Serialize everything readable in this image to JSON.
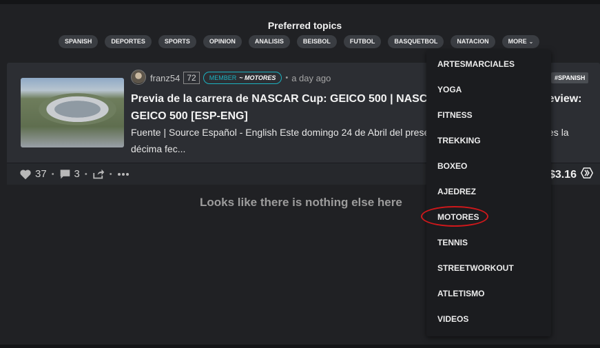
{
  "topics": {
    "title": "Preferred topics",
    "chips": [
      "SPANISH",
      "DEPORTES",
      "SPORTS",
      "OPINION",
      "ANALISIS",
      "BEISBOL",
      "FUTBOL",
      "BASQUETBOL",
      "NATACION"
    ],
    "more_label": "MORE"
  },
  "post": {
    "author": "franz54",
    "reputation": "72",
    "member_prefix": "MEMBER",
    "community": "~ MOTORES",
    "time": "a day ago",
    "tag": "#SPANISH",
    "title": "Previa de la carrera de NASCAR Cup: GEICO 500 | NASCAR Cup Series Race Preview: GEICO 500 [ESP-ENG]",
    "excerpt": "Fuente | Source Español - English Este domingo 24 de Abril del presente año se disputará lo que es la décima fec...",
    "votes": "37",
    "comments": "3",
    "payout": "$3.16"
  },
  "empty_message": "Looks like there is nothing else here",
  "dropdown": {
    "items": [
      "ARTESMARCIALES",
      "YOGA",
      "FITNESS",
      "TREKKING",
      "BOXEO",
      "AJEDREZ",
      "MOTORES",
      "TENNIS",
      "STREETWORKOUT",
      "ATLETISMO",
      "VIDEOS"
    ],
    "highlighted": "MOTORES",
    "highlight_color": "#d0181b"
  },
  "colors": {
    "accent": "#1bb3c2",
    "background": "#202124",
    "card": "#2c2e33"
  }
}
